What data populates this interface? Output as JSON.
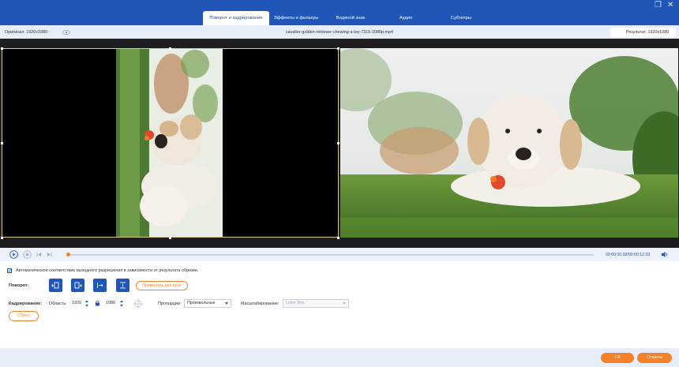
{
  "tabs": [
    {
      "label": "Поворот и кадрирование"
    },
    {
      "label": "Эффекты и фильтры"
    },
    {
      "label": "Водяной знак"
    },
    {
      "label": "Аудио"
    },
    {
      "label": "Субтитры"
    }
  ],
  "info": {
    "original": "Оригинал: 1920x1080",
    "filename": "cavalier-golden-retriever-chewing-a-toy-7315-1080p.mp4",
    "result": "Результат: 1920x1080"
  },
  "playback": {
    "time": "00:00:00.00/00:00:12.03",
    "progress": 0.0
  },
  "controls": {
    "auto_fit_label": "Автоматическое соответствие выходного разрешения в зависимости от результата обрезки.",
    "auto_fit_checked": true,
    "rotation_label": "Поворот:",
    "apply_all_label": "Применить для всех",
    "crop_label": "Кадрирование:",
    "area_label": "Область:",
    "width_value": "1920",
    "height_value": "1080",
    "ratio_label": "Пропорции:",
    "ratio_value": "Произвольные",
    "scale_label": "Масштабирование:",
    "scale_value": "Letter Box",
    "reset_label": "Сброс"
  },
  "footer": {
    "ok_label": "ОК",
    "cancel_label": "Отмена"
  },
  "colors": {
    "accent": "#1f56b8",
    "orange": "#f5822a"
  }
}
